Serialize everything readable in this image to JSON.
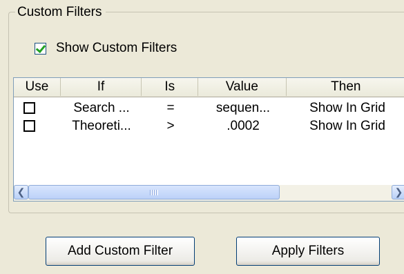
{
  "group": {
    "title": "Custom Filters"
  },
  "show_custom_filters": {
    "label": "Show Custom Filters",
    "checked": true
  },
  "table": {
    "columns": [
      "Use",
      "If",
      "Is",
      "Value",
      "Then"
    ],
    "rows": [
      {
        "use": false,
        "if": "Search ...",
        "is": "=",
        "value": "sequen...",
        "then": "Show In Grid"
      },
      {
        "use": false,
        "if": "Theoreti...",
        "is": ">",
        "value": ".0002",
        "then": "Show In Grid"
      }
    ]
  },
  "icons": {
    "scroll_left": "chevron-left-icon",
    "scroll_right": "chevron-right-icon"
  },
  "buttons": {
    "add": "Add Custom Filter",
    "apply": "Apply Filters"
  }
}
